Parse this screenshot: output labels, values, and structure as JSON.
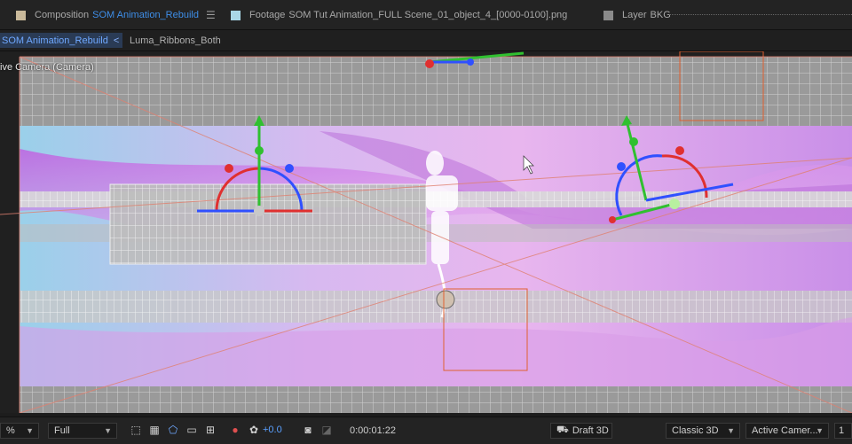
{
  "tabs": [
    {
      "prefix": "Composition",
      "name": "SOM Animation_Rebuild",
      "swatch": "#c9b99a"
    },
    {
      "prefix": "Footage",
      "name": "SOM Tut Animation_FULL Scene_01_object_4_[0000-0100].png",
      "swatch": "#a9d6e6"
    },
    {
      "prefix": "Layer",
      "name": "BKG",
      "swatch": "#8a8a8a"
    }
  ],
  "menu_icon": "☰",
  "breadcrumbs": {
    "active": "SOM Animation_Rebuild",
    "arrow": "<",
    "other": "Luma_Ribbons_Both"
  },
  "viewer": {
    "camera_label": "ive Camera (Camera)"
  },
  "bottom": {
    "zoom": "%",
    "resolution": "Full",
    "exposure": "+0.0",
    "timecode": "0:00:01:22",
    "draft3d": "Draft 3D",
    "renderer": "Classic 3D",
    "camera": "Active Camer...",
    "views": "1"
  },
  "colors": {
    "accent": "#3e8ee8",
    "gizmo_x": "#e03030",
    "gizmo_y": "#30c030",
    "gizmo_z": "#3050ff"
  },
  "icons": [
    "region-of-interest-icon",
    "transparency-grid-icon",
    "mask-path-icon",
    "safe-zones-icon",
    "grid-icon",
    "color-channels-icon",
    "exposure-icon",
    "snapshot-icon",
    "show-snapshot-icon"
  ]
}
